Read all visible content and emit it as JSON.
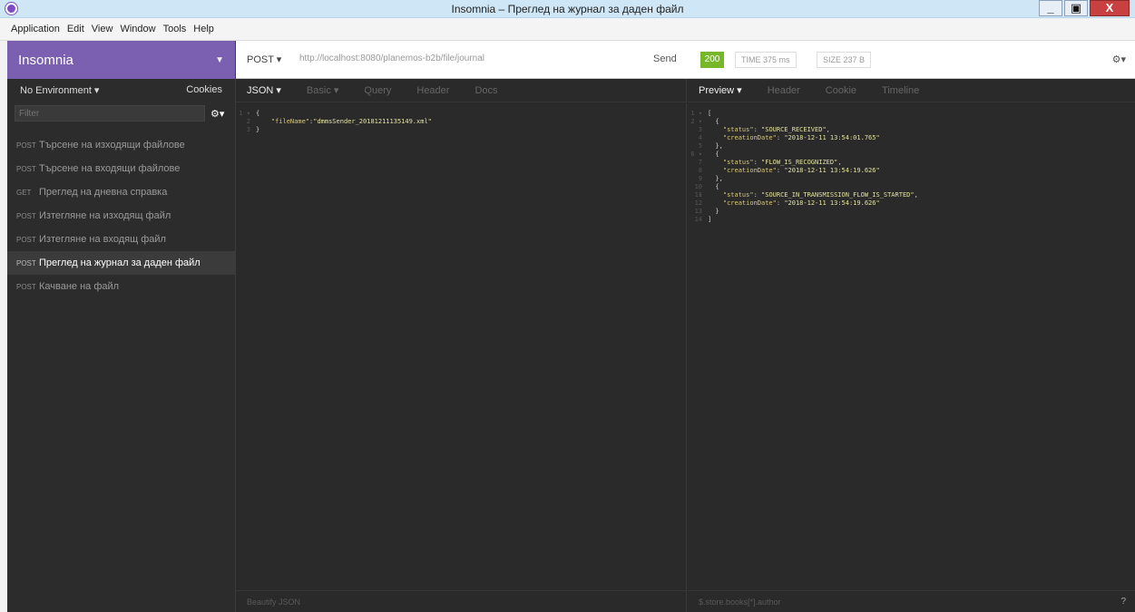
{
  "window": {
    "title": "Insomnia – Преглед на журнал за даден файл",
    "minimize": "_",
    "maximize": "▣",
    "close": "X"
  },
  "menu": [
    "Application",
    "Edit",
    "View",
    "Window",
    "Tools",
    "Help"
  ],
  "sidebar": {
    "brand": "Insomnia",
    "environment": "No Environment ▾",
    "cookies": "Cookies",
    "filter_placeholder": "Filter",
    "requests": [
      {
        "method": "POST",
        "label": "Търсене на изходящи файлове"
      },
      {
        "method": "POST",
        "label": "Търсене на входящи файлове"
      },
      {
        "method": "GET",
        "label": "Преглед на дневна справка"
      },
      {
        "method": "POST",
        "label": "Изтегляне на изходящ файл"
      },
      {
        "method": "POST",
        "label": "Изтегляне на входящ файл"
      },
      {
        "method": "POST",
        "label": "Преглед на журнал за даден файл"
      },
      {
        "method": "POST",
        "label": "Качване на файл"
      }
    ]
  },
  "request": {
    "method": "POST ▾",
    "url": "http://localhost:8080/planemos-b2b/file/journal",
    "send": "Send"
  },
  "response_meta": {
    "status": "200",
    "time": "TIME 375 ms",
    "size": "SIZE 237 B"
  },
  "left_tabs": [
    "JSON ▾",
    "Basic ▾",
    "Query",
    "Header",
    "Docs"
  ],
  "right_tabs": [
    "Preview ▾",
    "Header",
    "Cookie",
    "Timeline"
  ],
  "left_footer": "Beautify JSON",
  "right_footer": "$.store.books[*].author",
  "help_icon": "?",
  "colors": {
    "brand": "#7b5fb0",
    "status_ok": "#76b82a",
    "panel": "#2a2a2a"
  }
}
